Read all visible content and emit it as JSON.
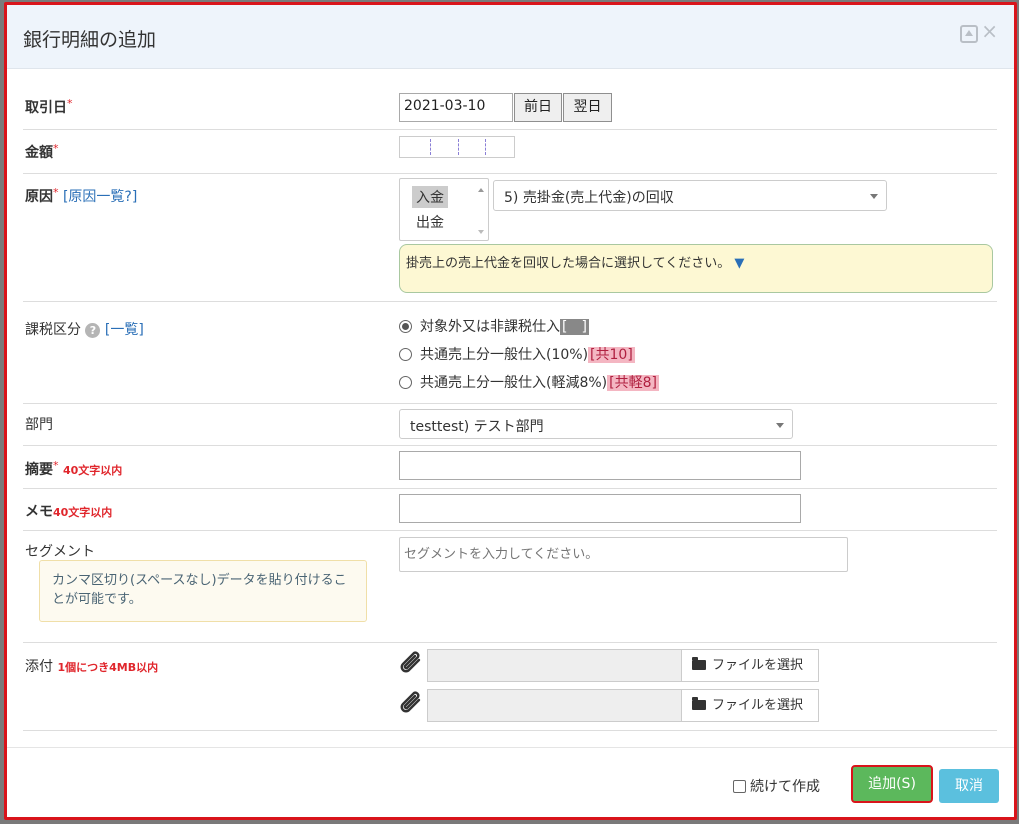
{
  "modal": {
    "title": "銀行明細の追加",
    "close_glyph": "×"
  },
  "torihikibi": {
    "label": "取引日",
    "required_mark": "*",
    "value": "2021-03-10",
    "prev_label": "前日",
    "next_label": "翌日"
  },
  "kingaku": {
    "label": "金額",
    "required_mark": "*",
    "value": ""
  },
  "genin": {
    "label": "原因",
    "required_mark": "*",
    "list_link": "[原因一覧?]",
    "type_options": [
      "入金",
      "出金"
    ],
    "type_selected": "入金",
    "reason_selected": "5) 売掛金(売上代金)の回収",
    "hint_text": "掛売上の売上代金を回収した場合に選択してください。",
    "hint_toggle": "▼"
  },
  "kazei": {
    "label": "課税区分",
    "help_glyph": "?",
    "list_link": "[一覧]",
    "options": [
      {
        "label": "対象外又は非課税仕入",
        "tag": "[　]",
        "selected": true
      },
      {
        "label": "共通売上分一般仕入(10%)",
        "tag": "[共10]",
        "selected": false
      },
      {
        "label": "共通売上分一般仕入(軽減8%)",
        "tag": "[共軽8]",
        "selected": false
      }
    ]
  },
  "bumon": {
    "label": "部門",
    "selected": "testtest) テスト部門"
  },
  "tekiyo": {
    "label": "摘要",
    "required_mark": "*",
    "note": "40文字以内",
    "value": ""
  },
  "memo": {
    "label": "メモ",
    "note": "40文字以内",
    "value": ""
  },
  "segment": {
    "label": "セグメント",
    "placeholder": "セグメントを入力してください。",
    "help_text": "カンマ区切り(スペースなし)データを貼り付けることが可能です。"
  },
  "tenpu": {
    "label": "添付",
    "note": "1個につき4MB以内",
    "file_button_label": "ファイルを選択"
  },
  "footer": {
    "continue_label": "続けて作成",
    "add_label": "追加(S)",
    "cancel_label": "取消"
  }
}
